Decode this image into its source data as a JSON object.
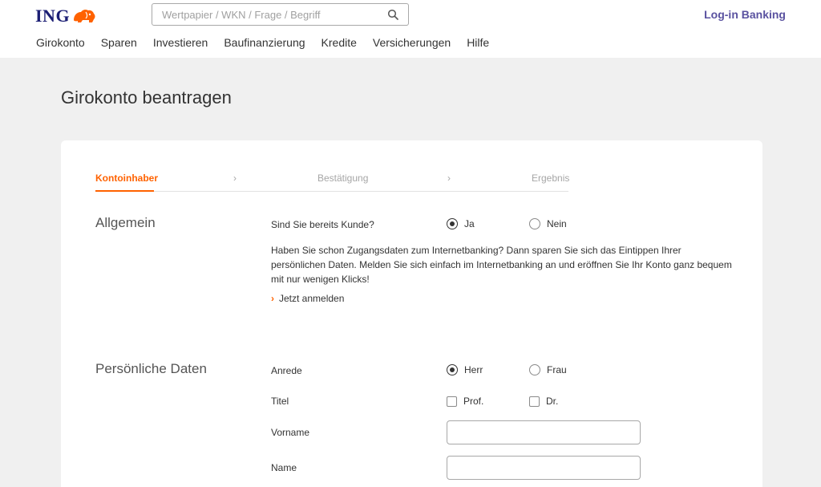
{
  "header": {
    "logo_text": "ING",
    "search_placeholder": "Wertpapier / WKN / Frage / Begriff",
    "login_label": "Log-in Banking",
    "nav": [
      "Girokonto",
      "Sparen",
      "Investieren",
      "Baufinanzierung",
      "Kredite",
      "Versicherungen",
      "Hilfe"
    ]
  },
  "page_title": "Girokonto beantragen",
  "steps": [
    {
      "label": "Kontoinhaber",
      "active": true
    },
    {
      "label": "Bestätigung",
      "active": false
    },
    {
      "label": "Ergebnis",
      "active": false
    }
  ],
  "step_separator": "›",
  "allgemein": {
    "title": "Allgemein",
    "kunde_question": "Sind Sie bereits Kunde?",
    "options": [
      "Ja",
      "Nein"
    ],
    "selected": "Ja",
    "info": "Haben Sie schon Zugangsdaten zum Internetbanking? Dann sparen Sie sich das Eintippen Ihrer persönlichen Daten. Melden Sie sich einfach im Internetbanking an und eröffnen Sie Ihr Konto ganz bequem mit nur wenigen Klicks!",
    "link_label": "Jetzt anmelden",
    "link_chevron": "›"
  },
  "persoenlich": {
    "title": "Persönliche Daten",
    "anrede_label": "Anrede",
    "anrede_options": [
      "Herr",
      "Frau"
    ],
    "anrede_selected": "Herr",
    "titel_label": "Titel",
    "titel_options": [
      "Prof.",
      "Dr."
    ],
    "vorname_label": "Vorname",
    "vorname_value": "",
    "name_label": "Name",
    "name_value": ""
  },
  "colors": {
    "brand_orange": "#ff6200",
    "brand_blue": "#1b1e74",
    "link_purple": "#5a52a0"
  },
  "icons": {
    "logo": "lion-icon",
    "search": "search-icon"
  }
}
